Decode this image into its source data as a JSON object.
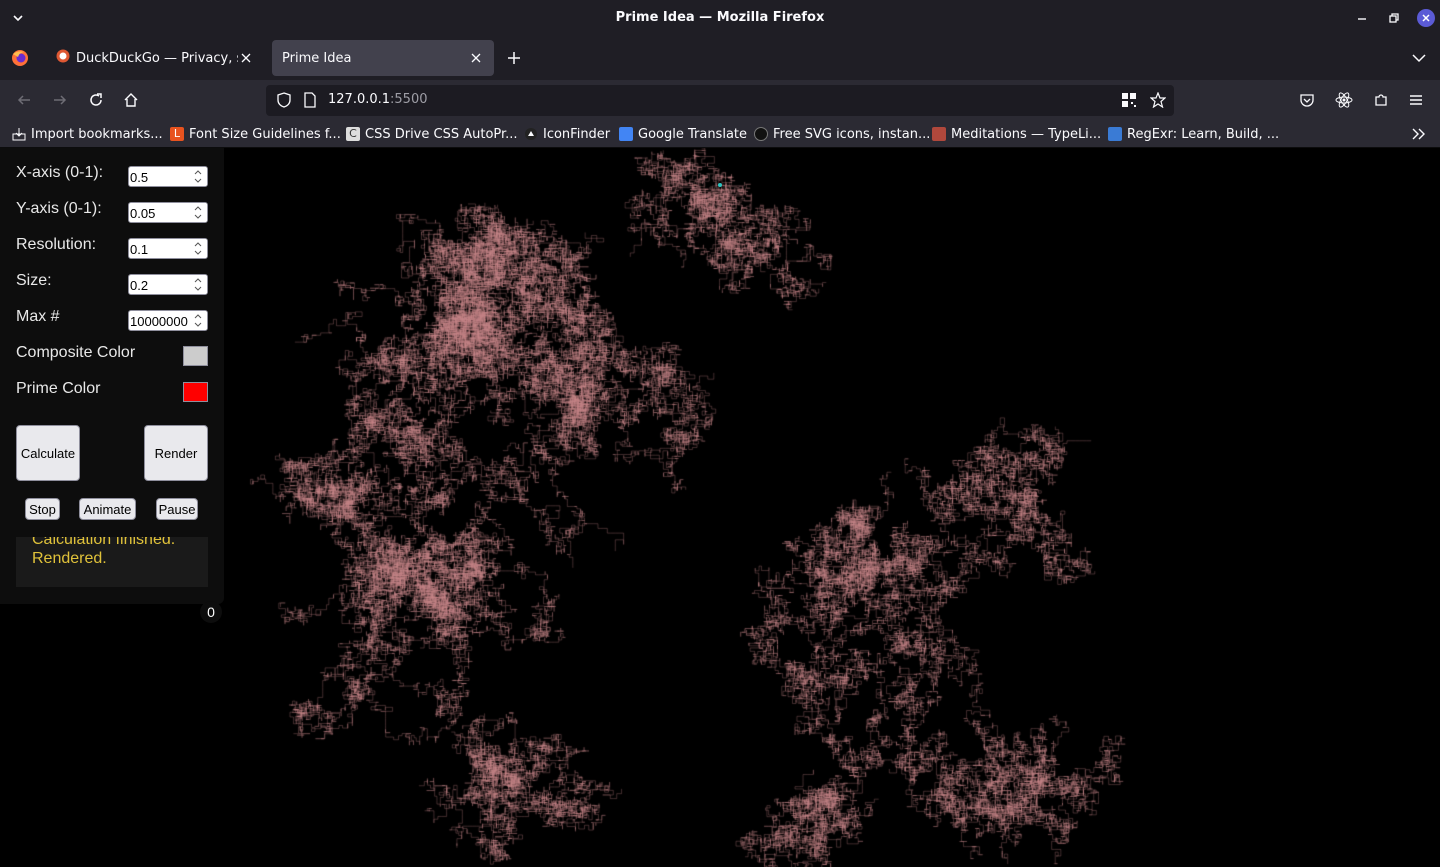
{
  "window": {
    "title": "Prime Idea — Mozilla Firefox"
  },
  "tabs": [
    {
      "label": "DuckDuckGo — Privacy, sim",
      "active": false
    },
    {
      "label": "Prime Idea",
      "active": true
    }
  ],
  "urlbar": {
    "host": "127.0.0.1",
    "port": ":5500"
  },
  "bookmarks": [
    {
      "label": "Import bookmarks...",
      "icon": "import-icon"
    },
    {
      "label": "Font Size Guidelines f...",
      "icon": "site-favicon-l"
    },
    {
      "label": "CSS Drive CSS AutoPr...",
      "icon": "site-favicon-c"
    },
    {
      "label": "IconFinder",
      "icon": "iconfinder-icon"
    },
    {
      "label": "Google Translate",
      "icon": "google-translate-icon"
    },
    {
      "label": "Free SVG icons, instan...",
      "icon": "svg-site-icon"
    },
    {
      "label": "Meditations — TypeLi...",
      "icon": "book-icon"
    },
    {
      "label": "RegExr: Learn, Build, ...",
      "icon": "regexr-icon"
    }
  ],
  "controls": {
    "x_axis": {
      "label": "X-axis (0-1):",
      "value": "0.5"
    },
    "y_axis": {
      "label": "Y-axis (0-1):",
      "value": "0.05"
    },
    "resolution": {
      "label": "Resolution:",
      "value": "0.1"
    },
    "size": {
      "label": "Size:",
      "value": "0.2"
    },
    "max": {
      "label": "Max #",
      "value": "10000000"
    },
    "composite_color": {
      "label": "Composite Color",
      "color": "#cccccc"
    },
    "prime_color": {
      "label": "Prime Color",
      "color": "#ff0000"
    }
  },
  "buttons": {
    "calculate": "Calculate",
    "render": "Render",
    "stop": "Stop",
    "animate": "Animate",
    "pause": "Pause"
  },
  "status": [
    "Calculation finished.",
    "Rendered."
  ],
  "counter": "0",
  "colors": {
    "fractal_point": "#c8888a",
    "marker": "#2ec4c0",
    "chrome_dark": "#1f1e25",
    "chrome_bar": "#2b2a33"
  }
}
